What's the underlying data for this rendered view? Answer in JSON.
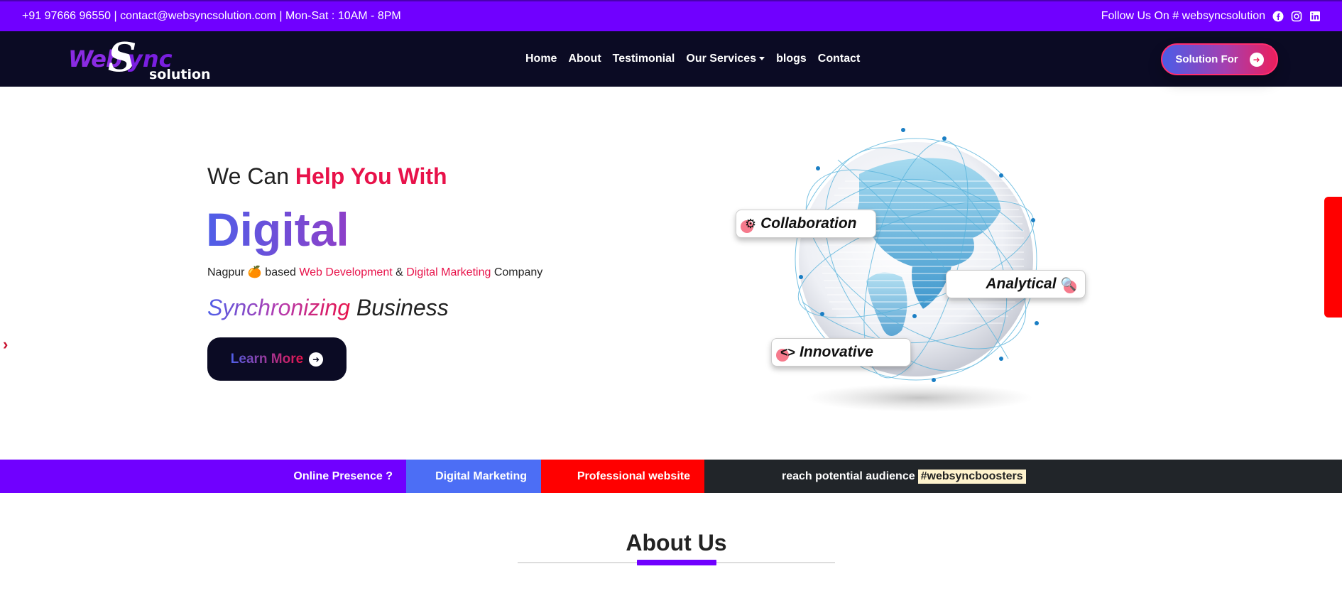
{
  "topbar": {
    "contact": "+91 97666 96550 | contact@websyncsolution.com | Mon-Sat : 10AM - 8PM",
    "follow": "Follow Us On # websyncsolution",
    "social_icons": [
      "facebook-icon",
      "instagram-icon",
      "linkedin-icon"
    ]
  },
  "logo": {
    "web": "Web",
    "s": "S",
    "sync": "ync",
    "solution": "solution"
  },
  "nav": {
    "items": [
      "Home",
      "About",
      "Testimonial",
      "Our Services",
      "blogs",
      "Contact"
    ],
    "cta": "Solution For"
  },
  "hero": {
    "line1_plain": "We Can ",
    "line1_accent": "Help You With",
    "headline": "Digital",
    "sub_a": "Nagpur 🍊 based ",
    "sub_b": "Web Development",
    "sub_c": " & ",
    "sub_d": "Digital Marketing",
    "sub_e": " Company",
    "sync_a": "Synchronizing",
    "sync_b": " Business",
    "button": "Learn More"
  },
  "globe": {
    "chips": [
      "Collaboration",
      "Analytical",
      "Innovative"
    ]
  },
  "ticker": {
    "items": [
      "Online Presence ?",
      "Digital Marketing",
      "Professional website"
    ],
    "last": "reach potential audience",
    "tag": "#websyncboosters"
  },
  "about": {
    "title": "About Us"
  },
  "colors": {
    "purple": "#7000ff",
    "navy": "#0b0b24",
    "red": "#e8124a",
    "blue": "#4c6ef5"
  }
}
